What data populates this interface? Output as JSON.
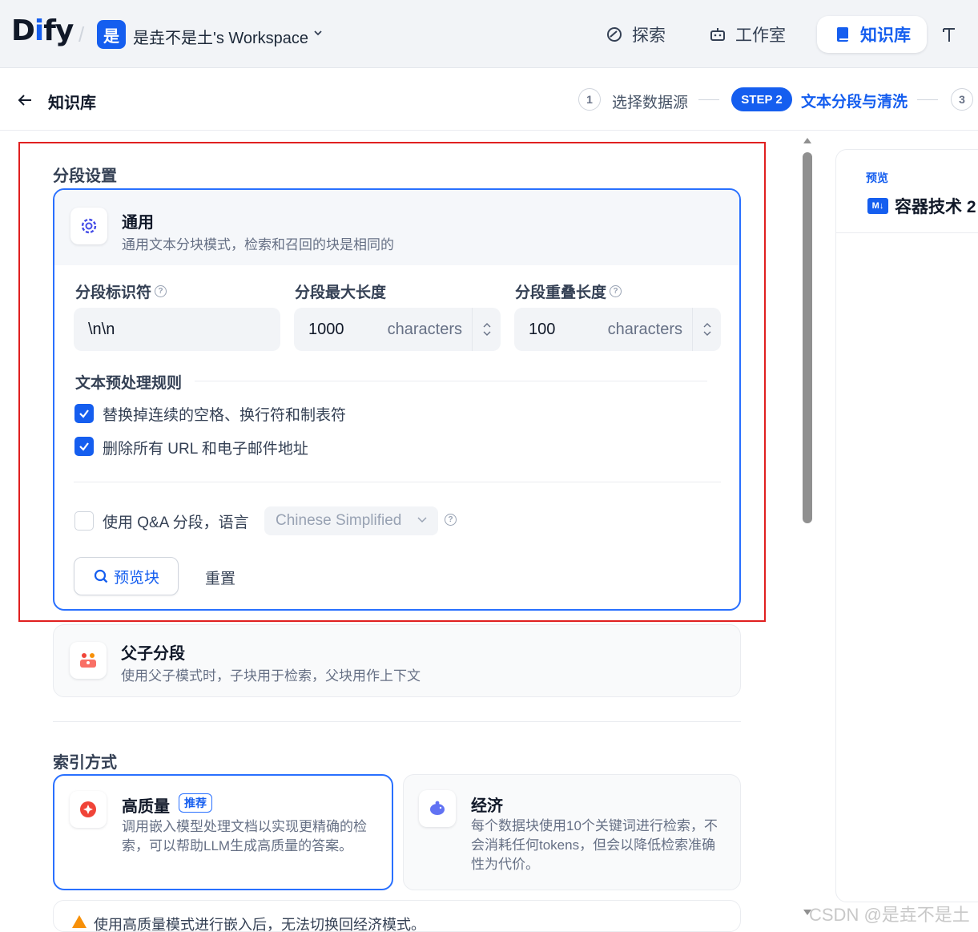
{
  "topbar": {
    "logo_main": "D",
    "logo_i": "i",
    "logo_rest": "fy",
    "workspace_badge": "是",
    "workspace_name": "是垚不是土's Workspace",
    "nav": [
      {
        "label": "探索",
        "icon": "explore-icon"
      },
      {
        "label": "工作室",
        "icon": "robot-icon"
      },
      {
        "label": "知识库",
        "icon": "book-icon",
        "active": true
      },
      {
        "label": "T",
        "icon": "tools-icon"
      }
    ]
  },
  "subheader": {
    "title": "知识库",
    "steps": [
      {
        "num": "1",
        "label": "选择数据源"
      },
      {
        "badge": "STEP 2",
        "label": "文本分段与清洗"
      },
      {
        "num": "3",
        "label": ""
      }
    ]
  },
  "segment": {
    "section_title": "分段设置",
    "general": {
      "title": "通用",
      "desc": "通用文本分块模式，检索和召回的块是相同的",
      "separator_label": "分段标识符",
      "separator_value": "\\n\\n",
      "max_len_label": "分段最大长度",
      "max_len_value": "1000",
      "max_len_unit": "characters",
      "overlap_label": "分段重叠长度",
      "overlap_value": "100",
      "overlap_unit": "characters",
      "rules_title": "文本预处理规则",
      "rule1": "替换掉连续的空格、换行符和制表符",
      "rule2": "删除所有 URL 和电子邮件地址",
      "qa_label": "使用 Q&A 分段，语言",
      "qa_lang": "Chinese Simplified",
      "preview_btn": "预览块",
      "reset_btn": "重置"
    },
    "parent_child": {
      "title": "父子分段",
      "desc": "使用父子模式时，子块用于检索，父块用作上下文"
    }
  },
  "index": {
    "section_title": "索引方式",
    "high": {
      "title": "高质量",
      "badge": "推荐",
      "desc": "调用嵌入模型处理文档以实现更精确的检索，可以帮助LLM生成高质量的答案。"
    },
    "eco": {
      "title": "经济",
      "desc": "每个数据块使用10个关键词进行检索，不会消耗任何tokens，但会以降低检索准确性为代价。"
    },
    "warning": "使用高质量模式进行嵌入后，无法切换回经济模式。"
  },
  "preview": {
    "label": "预览",
    "doc_icon": "M↓",
    "doc_title": "容器技术 2"
  },
  "watermark": "CSDN @是垚不是土",
  "colors": {
    "accent": "#155eef",
    "highlight_box": "#e02020"
  }
}
